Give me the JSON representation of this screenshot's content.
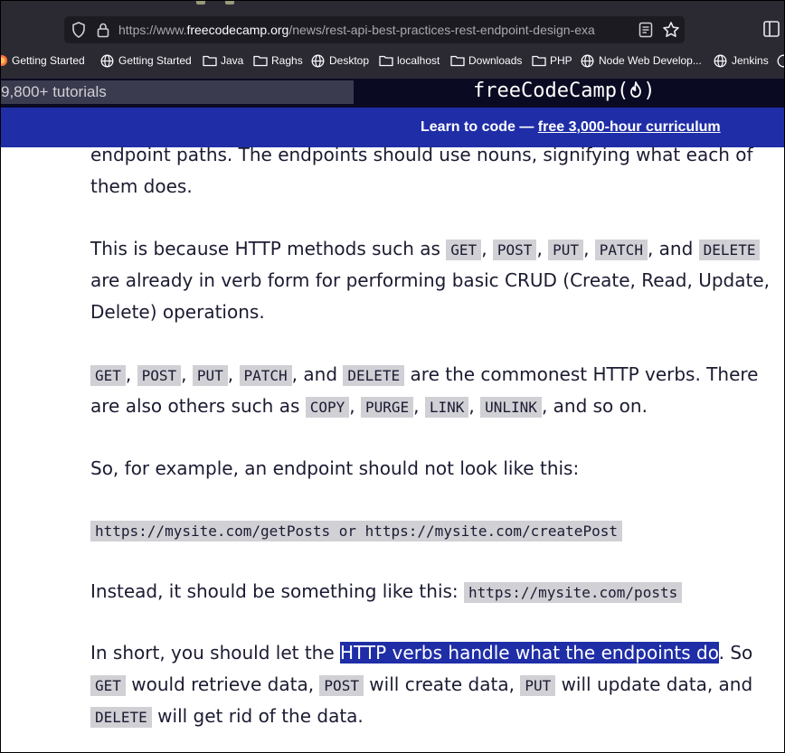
{
  "browser": {
    "url_prefix": "https://www.",
    "url_host": "freecodecamp.org",
    "url_path": "/news/rest-api-best-practices-rest-endpoint-design-exa",
    "bookmarks": [
      "Getting Started",
      "Getting Started",
      "Java",
      "Raghs",
      "Desktop",
      "localhost",
      "Downloads",
      "PHP",
      "Node Web Develop...",
      "Jenkins"
    ]
  },
  "site": {
    "search_placeholder": "9,800+ tutorials",
    "logo": "freeCodeCamp(🔥)",
    "logo_text": "freeCodeCamp(",
    "logo_close": ")",
    "banner_prefix": "Learn to code — ",
    "banner_link": "free 3,000-hour curriculum"
  },
  "article": {
    "p1_l1": "endpoint paths. The endpoints should use nouns, signifying what each of",
    "p1_l2": "them does.",
    "p2_l1_a": "This is because HTTP methods such as ",
    "p2_l3": "Delete) operations.",
    "p2_l2": "are already in verb form for performing basic CRUD (Create, Read, Update,",
    "verbs": [
      "GET",
      "POST",
      "PUT",
      "PATCH",
      "DELETE"
    ],
    "others": [
      "COPY",
      "PURGE",
      "LINK",
      "UNLINK"
    ],
    "and": ", and ",
    "comma": ",",
    "p3_tail": " are the commonest HTTP verbs. There",
    "p3_l2_a": "are also others such as ",
    "p3_l2_tail": ", and so on.",
    "p4": "So, for example, an endpoint should not look like this:",
    "bad_example": "https://mysite.com/getPosts or https://mysite.com/createPost",
    "p5": "Instead, it should be something like this: ",
    "good_example": "https://mysite.com/posts",
    "p6_a": "In short, you should let the ",
    "p6_hl": "HTTP verbs handle what the endpoints do",
    "p6_b": ". So",
    "p6_l2_1": " would retrieve data, ",
    "p6_l2_2": " will create data, ",
    "p6_l2_3": " will update data, and",
    "p6_l3": " will get rid of the data."
  },
  "colors": {
    "banner": "#1f2ea7",
    "header": "#0a0a23",
    "code_bg": "#d0d0d5",
    "highlight": "#1f2ea7"
  }
}
